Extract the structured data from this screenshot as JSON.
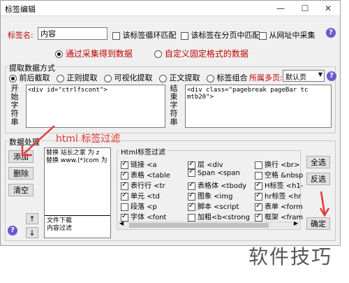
{
  "window": {
    "title": "标签编辑",
    "minimize": "—",
    "maximize": "☐",
    "close": "✕"
  },
  "tag_name": {
    "label": "标签名:",
    "value": "内容"
  },
  "options": {
    "loop_match": "该标签循环匹配",
    "paged_match": "该标签在分页中匹配",
    "url_collect": "从网址中采集"
  },
  "source_mode": {
    "collect": "通过采集得到数据",
    "custom": "自定义固定格式的数据"
  },
  "extract": {
    "group_title": "提取数据方式",
    "methods": [
      "前后截取",
      "正则提取",
      "可视化提取",
      "正文提取",
      "标签组合"
    ],
    "page_label": "所属多页:",
    "page_value": "默认页",
    "start_label": "开始字符串",
    "start_value": "<div id=\"ctrlfscont\">",
    "end_label": "结束字符串",
    "end_value": "<div class=\"pagebreak pageBar tc mtb20\">"
  },
  "processing": {
    "group_title": "数据处理",
    "add": "添加",
    "delete": "删除",
    "clear": "清空",
    "up": "↑",
    "down": "↓",
    "list_top": [
      "替换 站长之家 为 z",
      "替换 www.(*)com 为"
    ],
    "list_bottom": [
      "文件下载",
      "内容过滤"
    ]
  },
  "annotation": {
    "text": "html 标签过滤"
  },
  "html_filter": {
    "group_title": "Html标签过滤",
    "col1": [
      {
        "label": "链接 <a",
        "checked": true
      },
      {
        "label": "表格 <table",
        "checked": true
      },
      {
        "label": "表行行 <tr",
        "checked": true
      },
      {
        "label": "单元 <td",
        "checked": true
      },
      {
        "label": "段落 <p",
        "checked": false
      },
      {
        "label": "字体 <font",
        "checked": true
      }
    ],
    "col2": [
      {
        "label": "层 <div",
        "checked": true
      },
      {
        "label": "Span <span",
        "checked": true
      },
      {
        "label": "表格体 <tbody",
        "checked": true
      },
      {
        "label": "图象 <img",
        "checked": true
      },
      {
        "label": "脚本 <script",
        "checked": true
      },
      {
        "label": "加粗<b<strong",
        "checked": false
      }
    ],
    "col3": [
      {
        "label": "换行 <br>",
        "checked": false
      },
      {
        "label": "空格 &nbsp",
        "checked": false
      },
      {
        "label": "H标签 <h1-",
        "checked": true
      },
      {
        "label": "hr标签 <hr",
        "checked": true
      },
      {
        "label": "表单 <form",
        "checked": true
      },
      {
        "label": "框架 <fram",
        "checked": true
      }
    ],
    "select_all": "全选",
    "invert": "反选",
    "confirm": "确定"
  },
  "watermark": "软件技巧",
  "accent_color": "#c00000",
  "arrow_color": "#e53935"
}
